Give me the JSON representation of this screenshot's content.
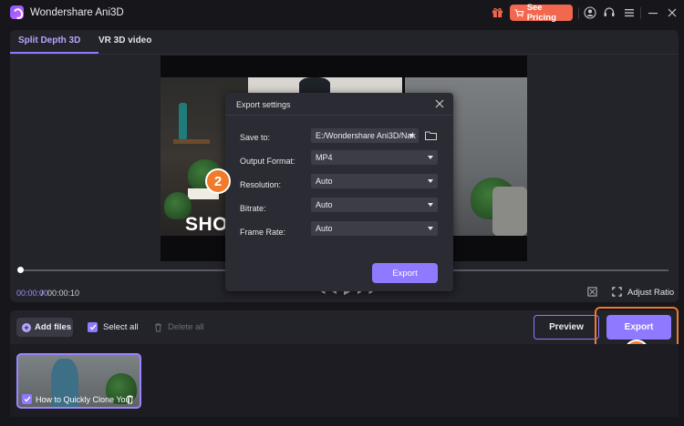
{
  "app": {
    "title": "Wondershare Ani3D"
  },
  "header": {
    "pricing_label": "See Pricing"
  },
  "tabs": [
    {
      "label": "Split Depth 3D",
      "active": true
    },
    {
      "label": "VR 3D video",
      "active": false
    }
  ],
  "video": {
    "overlay_text": "SHO"
  },
  "player": {
    "current_time": "00:00:00",
    "separator": "/",
    "total_time": "00:00:10",
    "adjust_ratio_label": "Adjust Ratio"
  },
  "toolbar": {
    "add_files_label": "Add files",
    "select_all_label": "Select all",
    "delete_all_label": "Delete all",
    "preview_label": "Preview",
    "export_label": "Export"
  },
  "files": [
    {
      "name": "How to Quickly Clone You"
    }
  ],
  "dialog": {
    "title": "Export settings",
    "fields": [
      {
        "label": "Save to:",
        "value": "E:/Wondershare Ani3D/Nak"
      },
      {
        "label": "Output Format:",
        "value": "MP4"
      },
      {
        "label": "Resolution:",
        "value": "Auto"
      },
      {
        "label": "Bitrate:",
        "value": "Auto"
      },
      {
        "label": "Frame Rate:",
        "value": "Auto"
      }
    ],
    "export_label": "Export"
  },
  "annotations": {
    "step1": "1",
    "step2": "2"
  },
  "colors": {
    "accent": "#8f79ff",
    "pricing": "#f2674f",
    "highlight": "#f07b2a"
  }
}
